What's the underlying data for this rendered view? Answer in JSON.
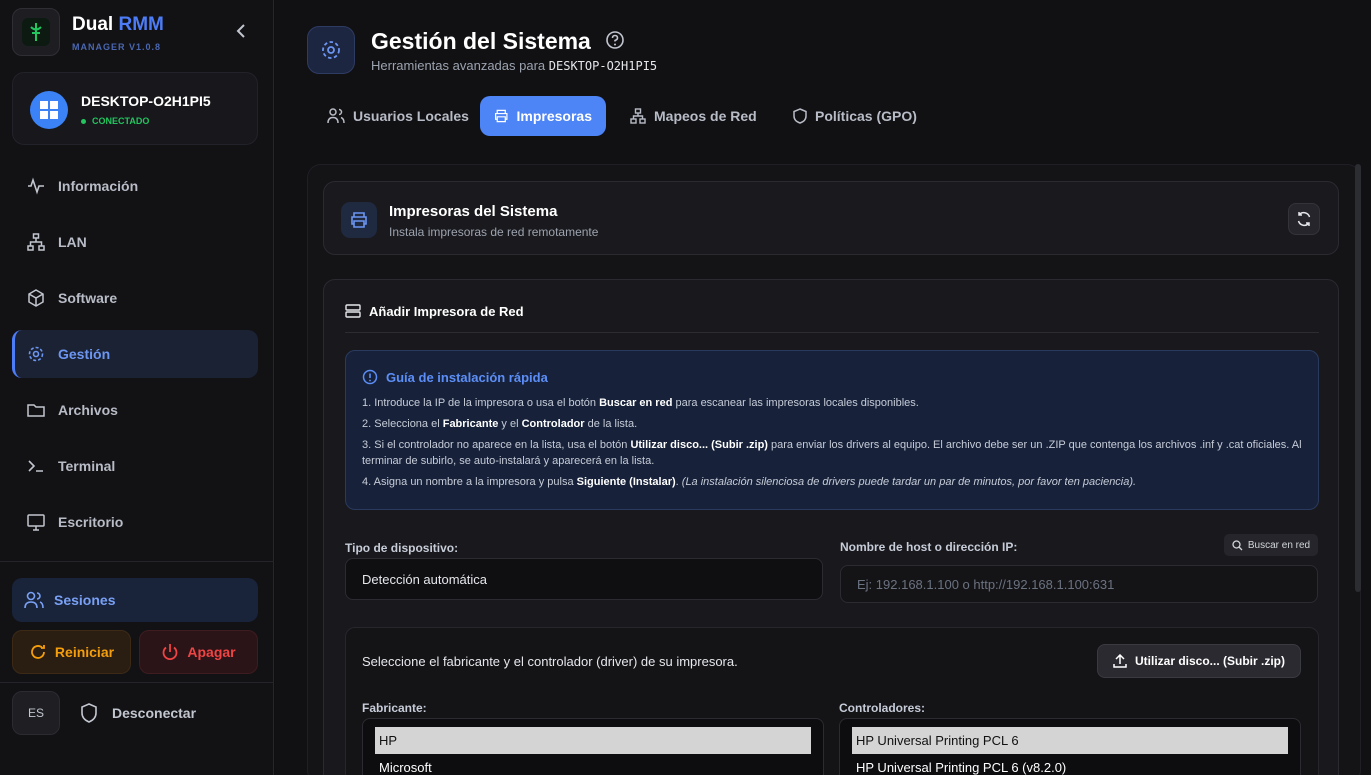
{
  "brand": {
    "name": "Dual",
    "accent": "RMM",
    "version": "MANAGER V1.0.8"
  },
  "device": {
    "name": "DESKTOP-O2H1PI5",
    "status": "CONECTADO"
  },
  "nav": [
    {
      "label": "Información"
    },
    {
      "label": "LAN"
    },
    {
      "label": "Software"
    },
    {
      "label": "Gestión"
    },
    {
      "label": "Archivos"
    },
    {
      "label": "Terminal"
    },
    {
      "label": "Escritorio"
    }
  ],
  "sidebar_bottom": {
    "sessions": "Sesiones",
    "restart": "Reiniciar",
    "shutdown": "Apagar",
    "lang": "ES",
    "logout": "Desconectar"
  },
  "header": {
    "title": "Gestión del Sistema",
    "subtitle_prefix": "Herramientas avanzadas para",
    "subtitle_host": "DESKTOP-O2H1PI5"
  },
  "tabs": [
    {
      "label": "Usuarios Locales"
    },
    {
      "label": "Impresoras"
    },
    {
      "label": "Mapeos de Red"
    },
    {
      "label": "Políticas (GPO)"
    }
  ],
  "printers_card": {
    "title": "Impresoras del Sistema",
    "subtitle": "Instala impresoras de red remotamente"
  },
  "add_printer": {
    "title": "Añadir Impresora de Red",
    "guide_title": "Guía de instalación rápida",
    "step1": {
      "a": "1. Introduce la IP de la impresora o usa el botón ",
      "b": "Buscar en red",
      "c": " para escanear las impresoras locales disponibles."
    },
    "step2": {
      "a": "2. Selecciona el ",
      "b": "Fabricante",
      "c": " y el ",
      "d": "Controlador",
      "e": " de la lista."
    },
    "step3": {
      "a": "3. Si el controlador no aparece en la lista, usa el botón ",
      "b": "Utilizar disco... (Subir .zip)",
      "c": " para enviar los drivers al equipo. El archivo debe ser un .ZIP que contenga los archivos .inf y .cat oficiales. Al terminar de subirlo, se auto-instalará y aparecerá en la lista."
    },
    "step4": {
      "a": "4. Asigna un nombre a la impresora y pulsa ",
      "b": "Siguiente (Instalar)",
      "c": ". ",
      "d": "(La instalación silenciosa de drivers puede tardar un par de minutos, por favor ten paciencia)."
    },
    "device_type_label": "Tipo de dispositivo:",
    "device_type_value": "Detección automática",
    "host_label": "Nombre de host o dirección IP:",
    "host_placeholder": "Ej: 192.168.1.100 o http://192.168.1.100:631",
    "scan_button": "Buscar en red",
    "driver_prompt": "Seleccione el fabricante y el controlador (driver) de su impresora.",
    "zip_button": "Utilizar disco... (Subir .zip)",
    "manufacturer_label": "Fabricante:",
    "manufacturers": [
      "HP",
      "Microsoft"
    ],
    "drivers_label": "Controladores:",
    "drivers": [
      "HP Universal Printing PCL 6",
      "HP Universal Printing PCL 6 (v8.2.0)"
    ]
  }
}
